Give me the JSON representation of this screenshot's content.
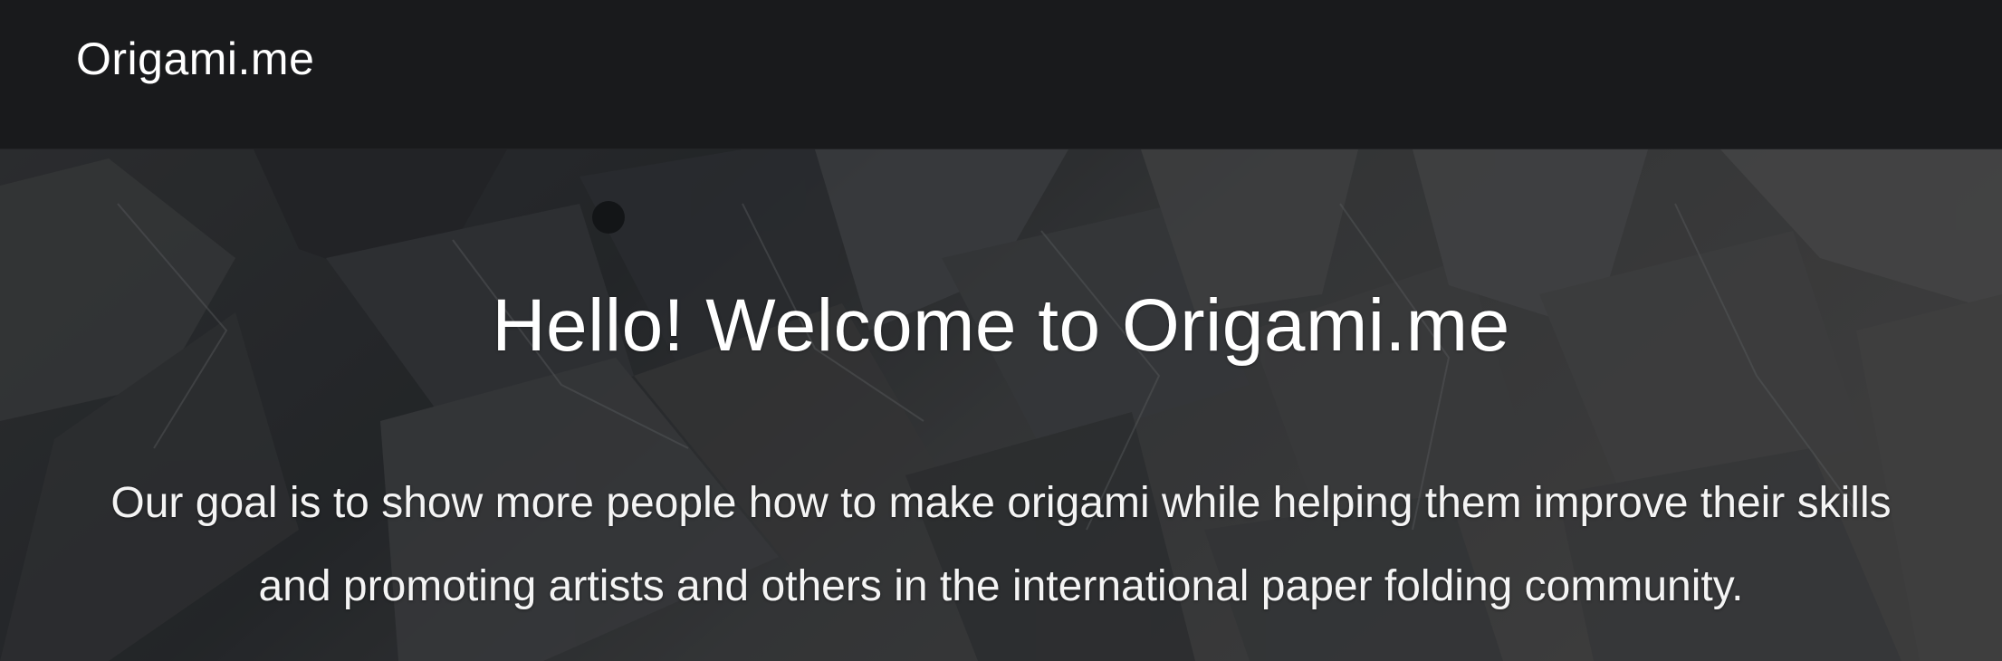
{
  "navbar": {
    "brand": "Origami.me"
  },
  "hero": {
    "title": "Hello! Welcome to Origami.me",
    "description": "Our goal is to show more people how to make origami while helping them improve their skills and promoting artists and others in the international paper folding community."
  },
  "colors": {
    "navbar_background": "#191a1c",
    "hero_overlay": "#141517",
    "text": "#ffffff"
  },
  "images": {
    "hero_background": "origami-paper-cranes-photo"
  }
}
